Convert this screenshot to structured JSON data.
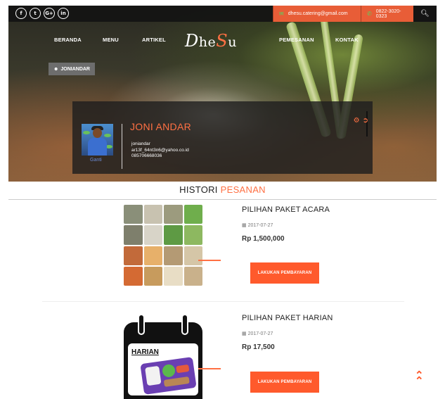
{
  "topbar": {
    "social_icons": [
      "facebook-icon",
      "twitter-icon",
      "google-plus-icon",
      "linkedin-icon"
    ],
    "social_glyphs": [
      "f",
      "t",
      "G+",
      "in"
    ],
    "email": "dhesu.catering@gmail.com",
    "phone": "0822-3020-0323"
  },
  "nav": {
    "items": [
      "BERANDA",
      "MENU",
      "ARTIKEL",
      "PEMESANAN",
      "KONTAK"
    ],
    "logo_parts": [
      "D",
      "he",
      "S",
      "u"
    ]
  },
  "user_tag": "JONIANDAR",
  "profile": {
    "name": "JONI ANDAR",
    "username": "joniandar",
    "email": "ar13f_64nt3n6@yahoo.co.id",
    "phone": "085706668036",
    "change_photo": "Ganti"
  },
  "history": {
    "title_main": "HISTORI",
    "title_accent": "PESANAN",
    "orders": [
      {
        "name": "PILIHAN PAKET ACARA",
        "date": "2017-07-27",
        "price": "Rp 1,500,000",
        "button": "LAKUKAN PEMBAYARAN"
      },
      {
        "name": "PILIHAN PAKET HARIAN",
        "date": "2017-07-27",
        "price": "Rp 17,500",
        "button": "LAKUKAN PEMBAYARAN",
        "image_label": "HARIAN"
      }
    ]
  },
  "colors": {
    "accent": "#ff7043",
    "button": "#ff5a2c",
    "topbar": "#141414"
  }
}
